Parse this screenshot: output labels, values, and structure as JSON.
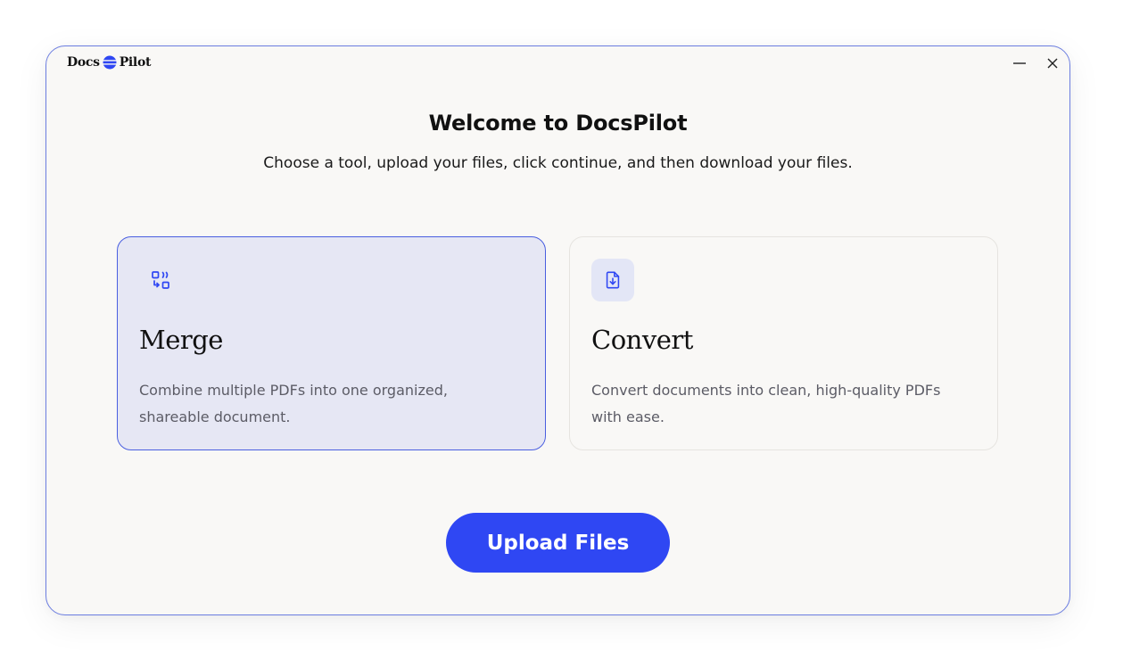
{
  "app": {
    "logo_left": "Docs",
    "logo_right": "Pilot",
    "minimize_icon": "minimize-icon",
    "close_icon": "close-icon"
  },
  "header": {
    "title": "Welcome to DocsPilot",
    "subtitle": "Choose a tool, upload your files, click continue, and then download your files."
  },
  "tools": [
    {
      "id": "merge",
      "icon": "merge-icon",
      "title": "Merge",
      "description_line1": "Combine multiple PDFs into one organized,",
      "description_line2": "shareable document.",
      "selected": true
    },
    {
      "id": "convert",
      "icon": "file-download-icon",
      "title": "Convert",
      "description_line1": "Convert documents into clean, high-quality PDFs",
      "description_line2": "with ease.",
      "selected": false
    }
  ],
  "actions": {
    "upload_label": "Upload Files"
  },
  "colors": {
    "accent": "#2f47f3",
    "selected_card_bg": "#e6e7f4",
    "window_border": "#6b7de0"
  }
}
